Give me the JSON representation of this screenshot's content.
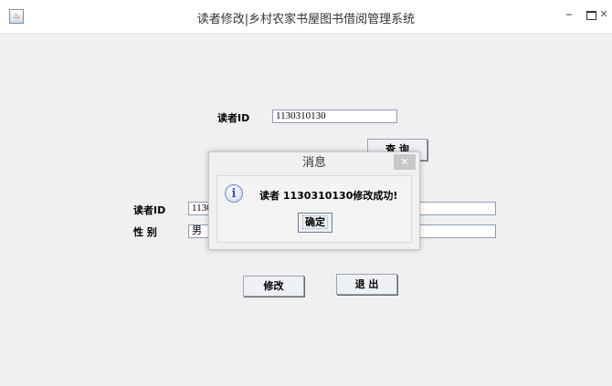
{
  "window": {
    "title": "读者修改|乡村农家书屋图书借阅管理系统",
    "app_icon": "java-cup-icon",
    "minimize_glyph": "–",
    "close_glyph": "✕"
  },
  "query": {
    "reader_id_label": "读者ID",
    "reader_id_value": "1130310130",
    "query_button": "查 询"
  },
  "form": {
    "reader_id_label": "读者ID",
    "reader_id_value": "1130310130",
    "gender_label": "性 别",
    "gender_value": "男",
    "modify_button": "修改",
    "exit_button": "退 出"
  },
  "dialog": {
    "title": "消息",
    "close_glyph": "✕",
    "icon": "info-icon",
    "icon_glyph": "i",
    "message": "读者 1130310130修改成功!",
    "ok_button": "确定"
  }
}
